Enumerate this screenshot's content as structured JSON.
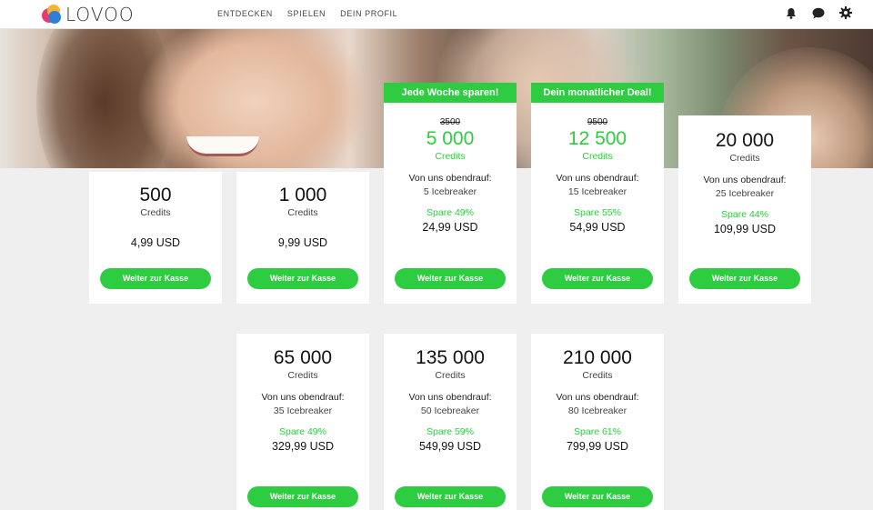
{
  "header": {
    "logo_text": "LOVOO",
    "nav": [
      "ENTDECKEN",
      "SPIELEN",
      "DEIN PROFIL"
    ]
  },
  "colors": {
    "accent_green": "#2ecc40"
  },
  "icons": [
    "bell-icon",
    "chat-bubble-icon",
    "gear-icon"
  ],
  "cards": [
    {
      "amount": "500",
      "unit": "Credits",
      "price": "4,99 USD",
      "button": "Weiter zur Kasse"
    },
    {
      "amount": "1 000",
      "unit": "Credits",
      "price": "9,99 USD",
      "button": "Weiter zur Kasse"
    },
    {
      "ribbon": "Jede Woche sparen!",
      "old_price": "3500",
      "amount": "5 000",
      "unit": "Credits",
      "bonus_label": "Von uns obendrauf:",
      "bonus_value": "5 Icebreaker",
      "save": "Spare 49%",
      "price": "24,99 USD",
      "button": "Weiter zur Kasse"
    },
    {
      "ribbon": "Dein monatlicher Deal!",
      "old_price": "9500",
      "amount": "12 500",
      "unit": "Credits",
      "bonus_label": "Von uns obendrauf:",
      "bonus_value": "15 Icebreaker",
      "save": "Spare 55%",
      "price": "54,99 USD",
      "button": "Weiter zur Kasse"
    },
    {
      "amount": "20 000",
      "unit": "Credits",
      "bonus_label": "Von uns obendrauf:",
      "bonus_value": "25 Icebreaker",
      "save": "Spare 44%",
      "price": "109,99 USD",
      "button": "Weiter zur Kasse"
    },
    {
      "amount": "65 000",
      "unit": "Credits",
      "bonus_label": "Von uns obendrauf:",
      "bonus_value": "35 Icebreaker",
      "save": "Spare 49%",
      "price": "329,99 USD",
      "button": "Weiter zur Kasse"
    },
    {
      "amount": "135 000",
      "unit": "Credits",
      "bonus_label": "Von uns obendrauf:",
      "bonus_value": "50 Icebreaker",
      "save": "Spare 59%",
      "price": "549,99 USD",
      "button": "Weiter zur Kasse"
    },
    {
      "amount": "210 000",
      "unit": "Credits",
      "bonus_label": "Von uns obendrauf:",
      "bonus_value": "80 Icebreaker",
      "save": "Spare 61%",
      "price": "799,99 USD",
      "button": "Weiter zur Kasse"
    }
  ]
}
